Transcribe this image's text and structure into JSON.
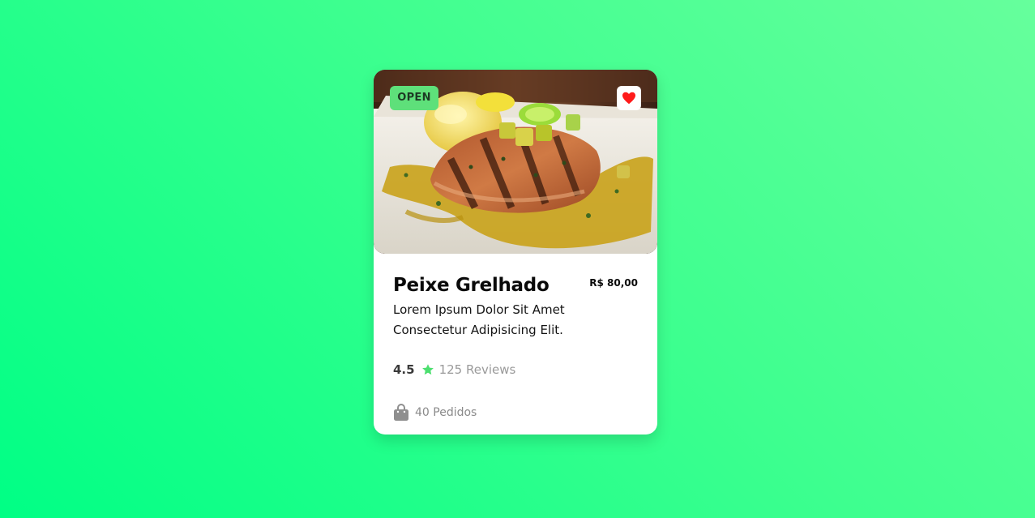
{
  "card": {
    "status_badge": "OPEN",
    "favorite_icon": "heart-icon",
    "image_alt": "grilled fish dish photo",
    "title": "Peixe Grelhado",
    "price": "R$ 80,00",
    "description": "Lorem Ipsum Dolor Sit Amet Consectetur Adipisicing Elit.",
    "rating": "4.5",
    "rating_icon": "star-icon",
    "reviews": "125 Reviews",
    "orders_icon": "shopping-bag-icon",
    "orders": "40 Pedidos"
  },
  "colors": {
    "background_start": "#00ff85",
    "background_end": "#66ff9c",
    "badge_bg": "#5ee07a",
    "star": "#4cdf6f",
    "heart": "#ff1a1a"
  }
}
